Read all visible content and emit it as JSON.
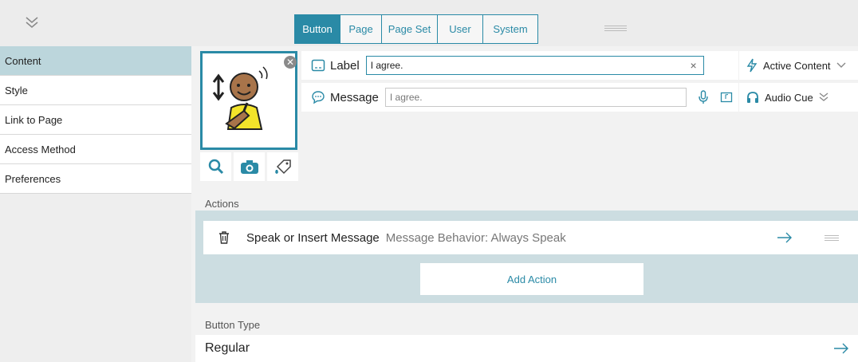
{
  "tabs": [
    {
      "label": "Button"
    },
    {
      "label": "Page"
    },
    {
      "label": "Page Set"
    },
    {
      "label": "User"
    },
    {
      "label": "System"
    }
  ],
  "sidebar": {
    "items": [
      {
        "label": "Content"
      },
      {
        "label": "Style"
      },
      {
        "label": "Link to Page"
      },
      {
        "label": "Access Method"
      },
      {
        "label": "Preferences"
      }
    ]
  },
  "fields": {
    "label_title": "Label",
    "label_value": "I agree.",
    "message_title": "Message",
    "message_placeholder": "I agree."
  },
  "options": {
    "active_content": "Active Content",
    "audio_cue": "Audio Cue"
  },
  "actions": {
    "section_title": "Actions",
    "action_name": "Speak or Insert Message",
    "action_detail": "Message Behavior: Always Speak",
    "add_label": "Add Action"
  },
  "button_type": {
    "section_title": "Button Type",
    "value": "Regular"
  },
  "colors": {
    "accent": "#2a8aa6",
    "selected": "#bcd6dc",
    "band": "#ccdde1"
  }
}
